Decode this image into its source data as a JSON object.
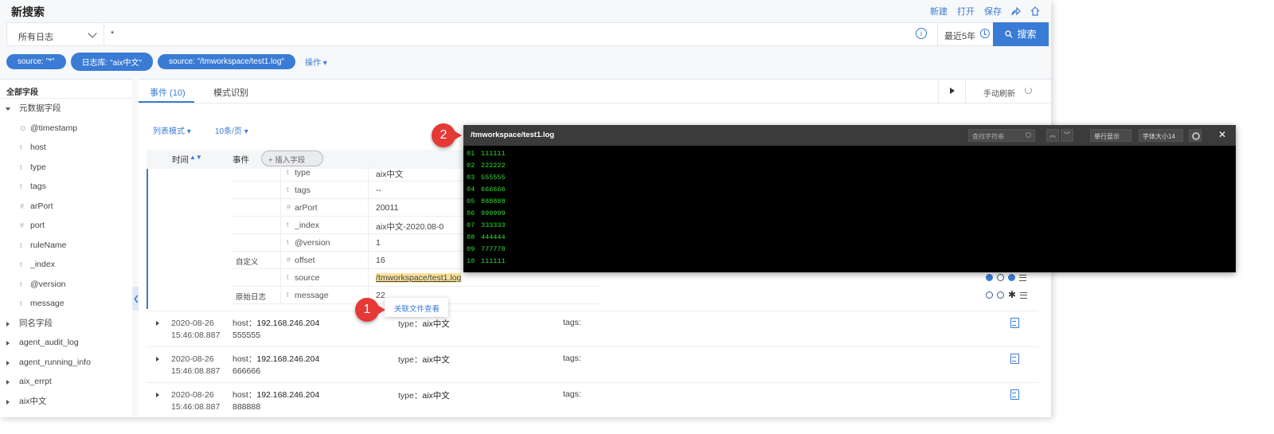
{
  "header": {
    "title": "新搜索",
    "actions": [
      "新建",
      "打开",
      "保存"
    ]
  },
  "search": {
    "source_select": "所有日志",
    "query": "*",
    "time_range": "最近5年",
    "button": "搜索"
  },
  "filters": [
    "source: \"*\"",
    "日志库: \"aix中文\"",
    "source: \"/tmworkspace/test1.log\""
  ],
  "filter_action": "操作",
  "sidebar": {
    "title": "全部字段",
    "meta_group": "元数据字段",
    "meta_fields": [
      {
        "type": "⊙",
        "name": "@timestamp"
      },
      {
        "type": "t",
        "name": "host"
      },
      {
        "type": "t",
        "name": "type"
      },
      {
        "type": "t",
        "name": "tags"
      },
      {
        "type": "#",
        "name": "arPort"
      },
      {
        "type": "#",
        "name": "port"
      },
      {
        "type": "t",
        "name": "ruleName"
      },
      {
        "type": "t",
        "name": "_index"
      },
      {
        "type": "t",
        "name": "@version"
      },
      {
        "type": "t",
        "name": "message"
      }
    ],
    "groups": [
      "同名字段",
      "agent_audit_log",
      "agent_running_info",
      "aix_errpt",
      "aix中文"
    ]
  },
  "tabs": {
    "events": "事件 (10)",
    "patterns": "模式识别",
    "refresh": "手动刷新"
  },
  "toolbar": {
    "mode": "列表模式",
    "page_size": "10条/页"
  },
  "table": {
    "col_time": "时间",
    "col_event": "事件",
    "insert_field": "插入字段"
  },
  "detail": [
    {
      "label": "",
      "type": "t",
      "key": "type",
      "value": "aix中文"
    },
    {
      "label": "",
      "type": "t",
      "key": "tags",
      "value": "--"
    },
    {
      "label": "",
      "type": "#",
      "key": "arPort",
      "value": "20011"
    },
    {
      "label": "",
      "type": "t",
      "key": "_index",
      "value": "aix中文-2020.08-0"
    },
    {
      "label": "",
      "type": "t",
      "key": "@version",
      "value": "1"
    },
    {
      "label": "自定义",
      "type": "#",
      "key": "offset",
      "value": "16"
    },
    {
      "label": "",
      "type": "t",
      "key": "source",
      "value": "/tmworkspace/test1.log"
    },
    {
      "label": "原始日志",
      "type": "t",
      "key": "message",
      "value": "22"
    }
  ],
  "events": [
    {
      "date": "2020-08-26",
      "time": "15:46:08.887",
      "host_label": "host：",
      "host": "192.168.246.204",
      "body": "555555",
      "type_label": "type：",
      "type": "aix中文",
      "tags_label": "tags:"
    },
    {
      "date": "2020-08-26",
      "time": "15:46:08.887",
      "host_label": "host：",
      "host": "192.168.246.204",
      "body": "666666",
      "type_label": "type：",
      "type": "aix中文",
      "tags_label": "tags:"
    },
    {
      "date": "2020-08-26",
      "time": "15:46:08.887",
      "host_label": "host：",
      "host": "192.168.246.204",
      "body": "888888",
      "type_label": "type：",
      "type": "aix中文",
      "tags_label": "tags:"
    }
  ],
  "popup": {
    "label": "关联文件查看"
  },
  "callouts": [
    "1",
    "2"
  ],
  "viewer": {
    "title": "/tmworkspace/test1.log",
    "search_placeholder": "查找字符串",
    "line_mode": "单行显示",
    "font_size": "字体大小14",
    "lines": [
      {
        "n": "01",
        "text": "111111"
      },
      {
        "n": "02",
        "text": "222222"
      },
      {
        "n": "03",
        "text": "555555"
      },
      {
        "n": "04",
        "text": "666666"
      },
      {
        "n": "05",
        "text": "888888"
      },
      {
        "n": "06",
        "text": "999999"
      },
      {
        "n": "07",
        "text": "333333"
      },
      {
        "n": "08",
        "text": "444444"
      },
      {
        "n": "09",
        "text": "777778"
      },
      {
        "n": "10",
        "text": "111111"
      }
    ]
  },
  "colors": {
    "accent": "#3a7bd5",
    "callout": "#e53935",
    "console_text": "#33dd33",
    "highlight": "#fbe29c"
  }
}
